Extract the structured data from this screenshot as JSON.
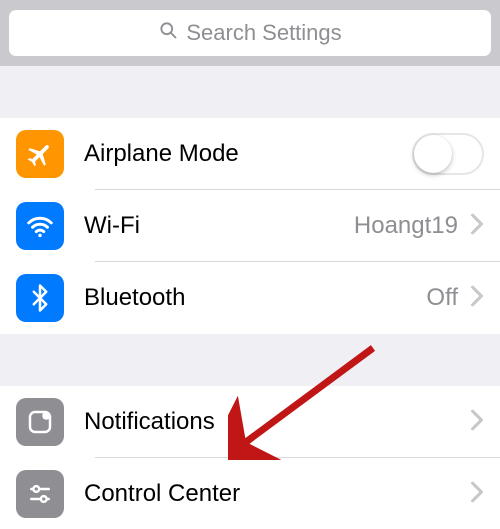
{
  "search": {
    "placeholder": "Search Settings"
  },
  "group1": {
    "airplane": {
      "label": "Airplane Mode",
      "on": false
    },
    "wifi": {
      "label": "Wi-Fi",
      "value": "Hoangt19"
    },
    "bluetooth": {
      "label": "Bluetooth",
      "value": "Off"
    }
  },
  "group2": {
    "notifications": {
      "label": "Notifications"
    },
    "controlcenter": {
      "label": "Control Center"
    }
  },
  "colors": {
    "orange": "#ff9500",
    "blue": "#007aff",
    "gray": "#8e8e93",
    "arrow": "#c01616"
  }
}
